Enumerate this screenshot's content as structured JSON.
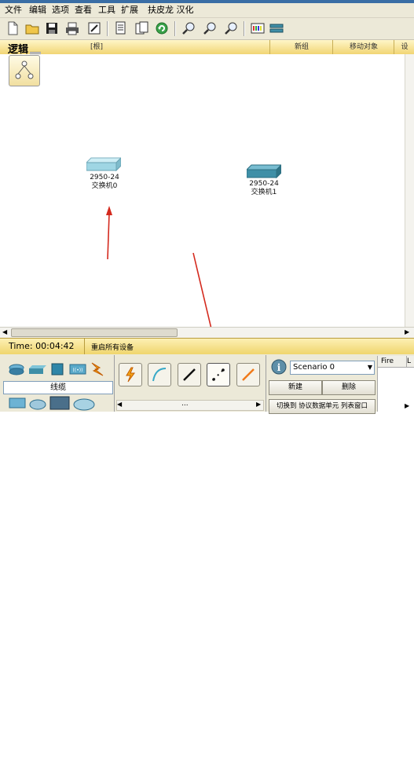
{
  "menu": {
    "items": [
      "文件",
      "编辑",
      "选项",
      "查看",
      "工具",
      "扩展",
      "扶皮龙 汉化"
    ]
  },
  "toolbar": {
    "buttons": [
      "new-file-icon",
      "open-folder-icon",
      "save-icon",
      "print-icon",
      "activity-wizard-icon",
      "copy-icon",
      "paste-icon",
      "undo-icon",
      "zoom-in-icon",
      "zoom-reset-icon",
      "zoom-out-icon",
      "palette-icon",
      "custom-device-icon"
    ]
  },
  "logic_bar": {
    "tab_label": "逻辑",
    "root_label": "[根]",
    "new_cluster": "新组",
    "move_object": "移动对象",
    "set_bg": "设"
  },
  "devices": [
    {
      "model": "2950-24",
      "name": "交换机0",
      "color": "#9fd6e4"
    },
    {
      "model": "2950-24",
      "name": "交换机1",
      "color": "#3f8fa7"
    }
  ],
  "status": {
    "time_label": "Time: 00:04:42",
    "power_cycle": "重启所有设备"
  },
  "bottom": {
    "category_label": "线缆",
    "cable_tools": [
      "auto-connect-icon",
      "console-cable-icon",
      "straight-through-icon",
      "crossover-icon",
      "fiber-icon"
    ],
    "scenario": "Scenario 0",
    "new_button": "新建",
    "delete_button": "删除",
    "toggle_pdu": "切换到 协议数据单元 列表窗口",
    "fire_col": "Fire",
    "last_col": "L",
    "more": "..."
  },
  "colors": {
    "annotation_arrow": "#d42a1e"
  }
}
